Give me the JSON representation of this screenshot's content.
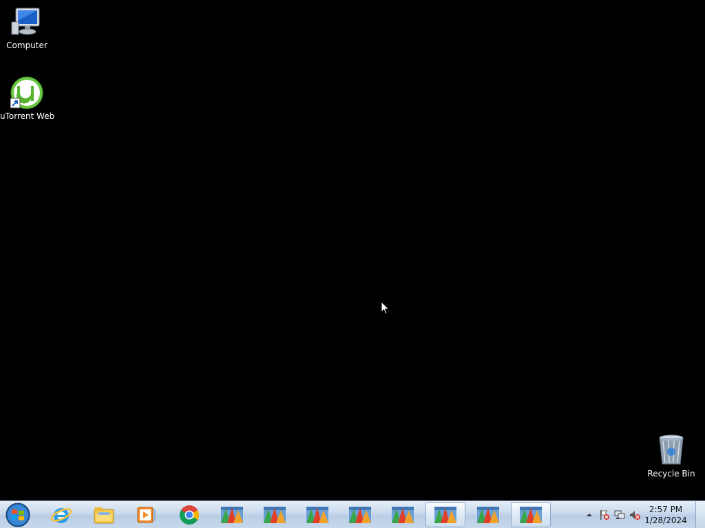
{
  "desktop": {
    "icons": [
      {
        "label": "Computer",
        "icon": "computer-icon"
      },
      {
        "label": "uTorrent Web",
        "icon": "utorrent-icon"
      },
      {
        "label": "Recycle Bin",
        "icon": "recycle-bin-icon"
      }
    ]
  },
  "taskbar": {
    "start": {
      "icon": "windows-start-orb-icon"
    },
    "buttons": [
      {
        "icon": "internet-explorer-icon",
        "active": false
      },
      {
        "icon": "file-explorer-icon",
        "active": false
      },
      {
        "icon": "media-player-icon",
        "active": false
      },
      {
        "icon": "chrome-icon",
        "active": false
      },
      {
        "icon": "app-window-icon",
        "active": false
      },
      {
        "icon": "app-window-icon",
        "active": false
      },
      {
        "icon": "app-window-icon",
        "active": false
      },
      {
        "icon": "app-window-icon",
        "active": false
      },
      {
        "icon": "app-window-icon",
        "active": false
      },
      {
        "icon": "app-window-icon",
        "active": true
      },
      {
        "icon": "app-window-icon",
        "active": false
      },
      {
        "icon": "app-window-icon",
        "active": true
      }
    ],
    "tray": {
      "icons": [
        "show-hidden-icons-arrow",
        "action-center-flag-icon",
        "network-icon",
        "volume-muted-icon"
      ],
      "time": "2:57 PM",
      "date": "1/28/2024"
    }
  }
}
